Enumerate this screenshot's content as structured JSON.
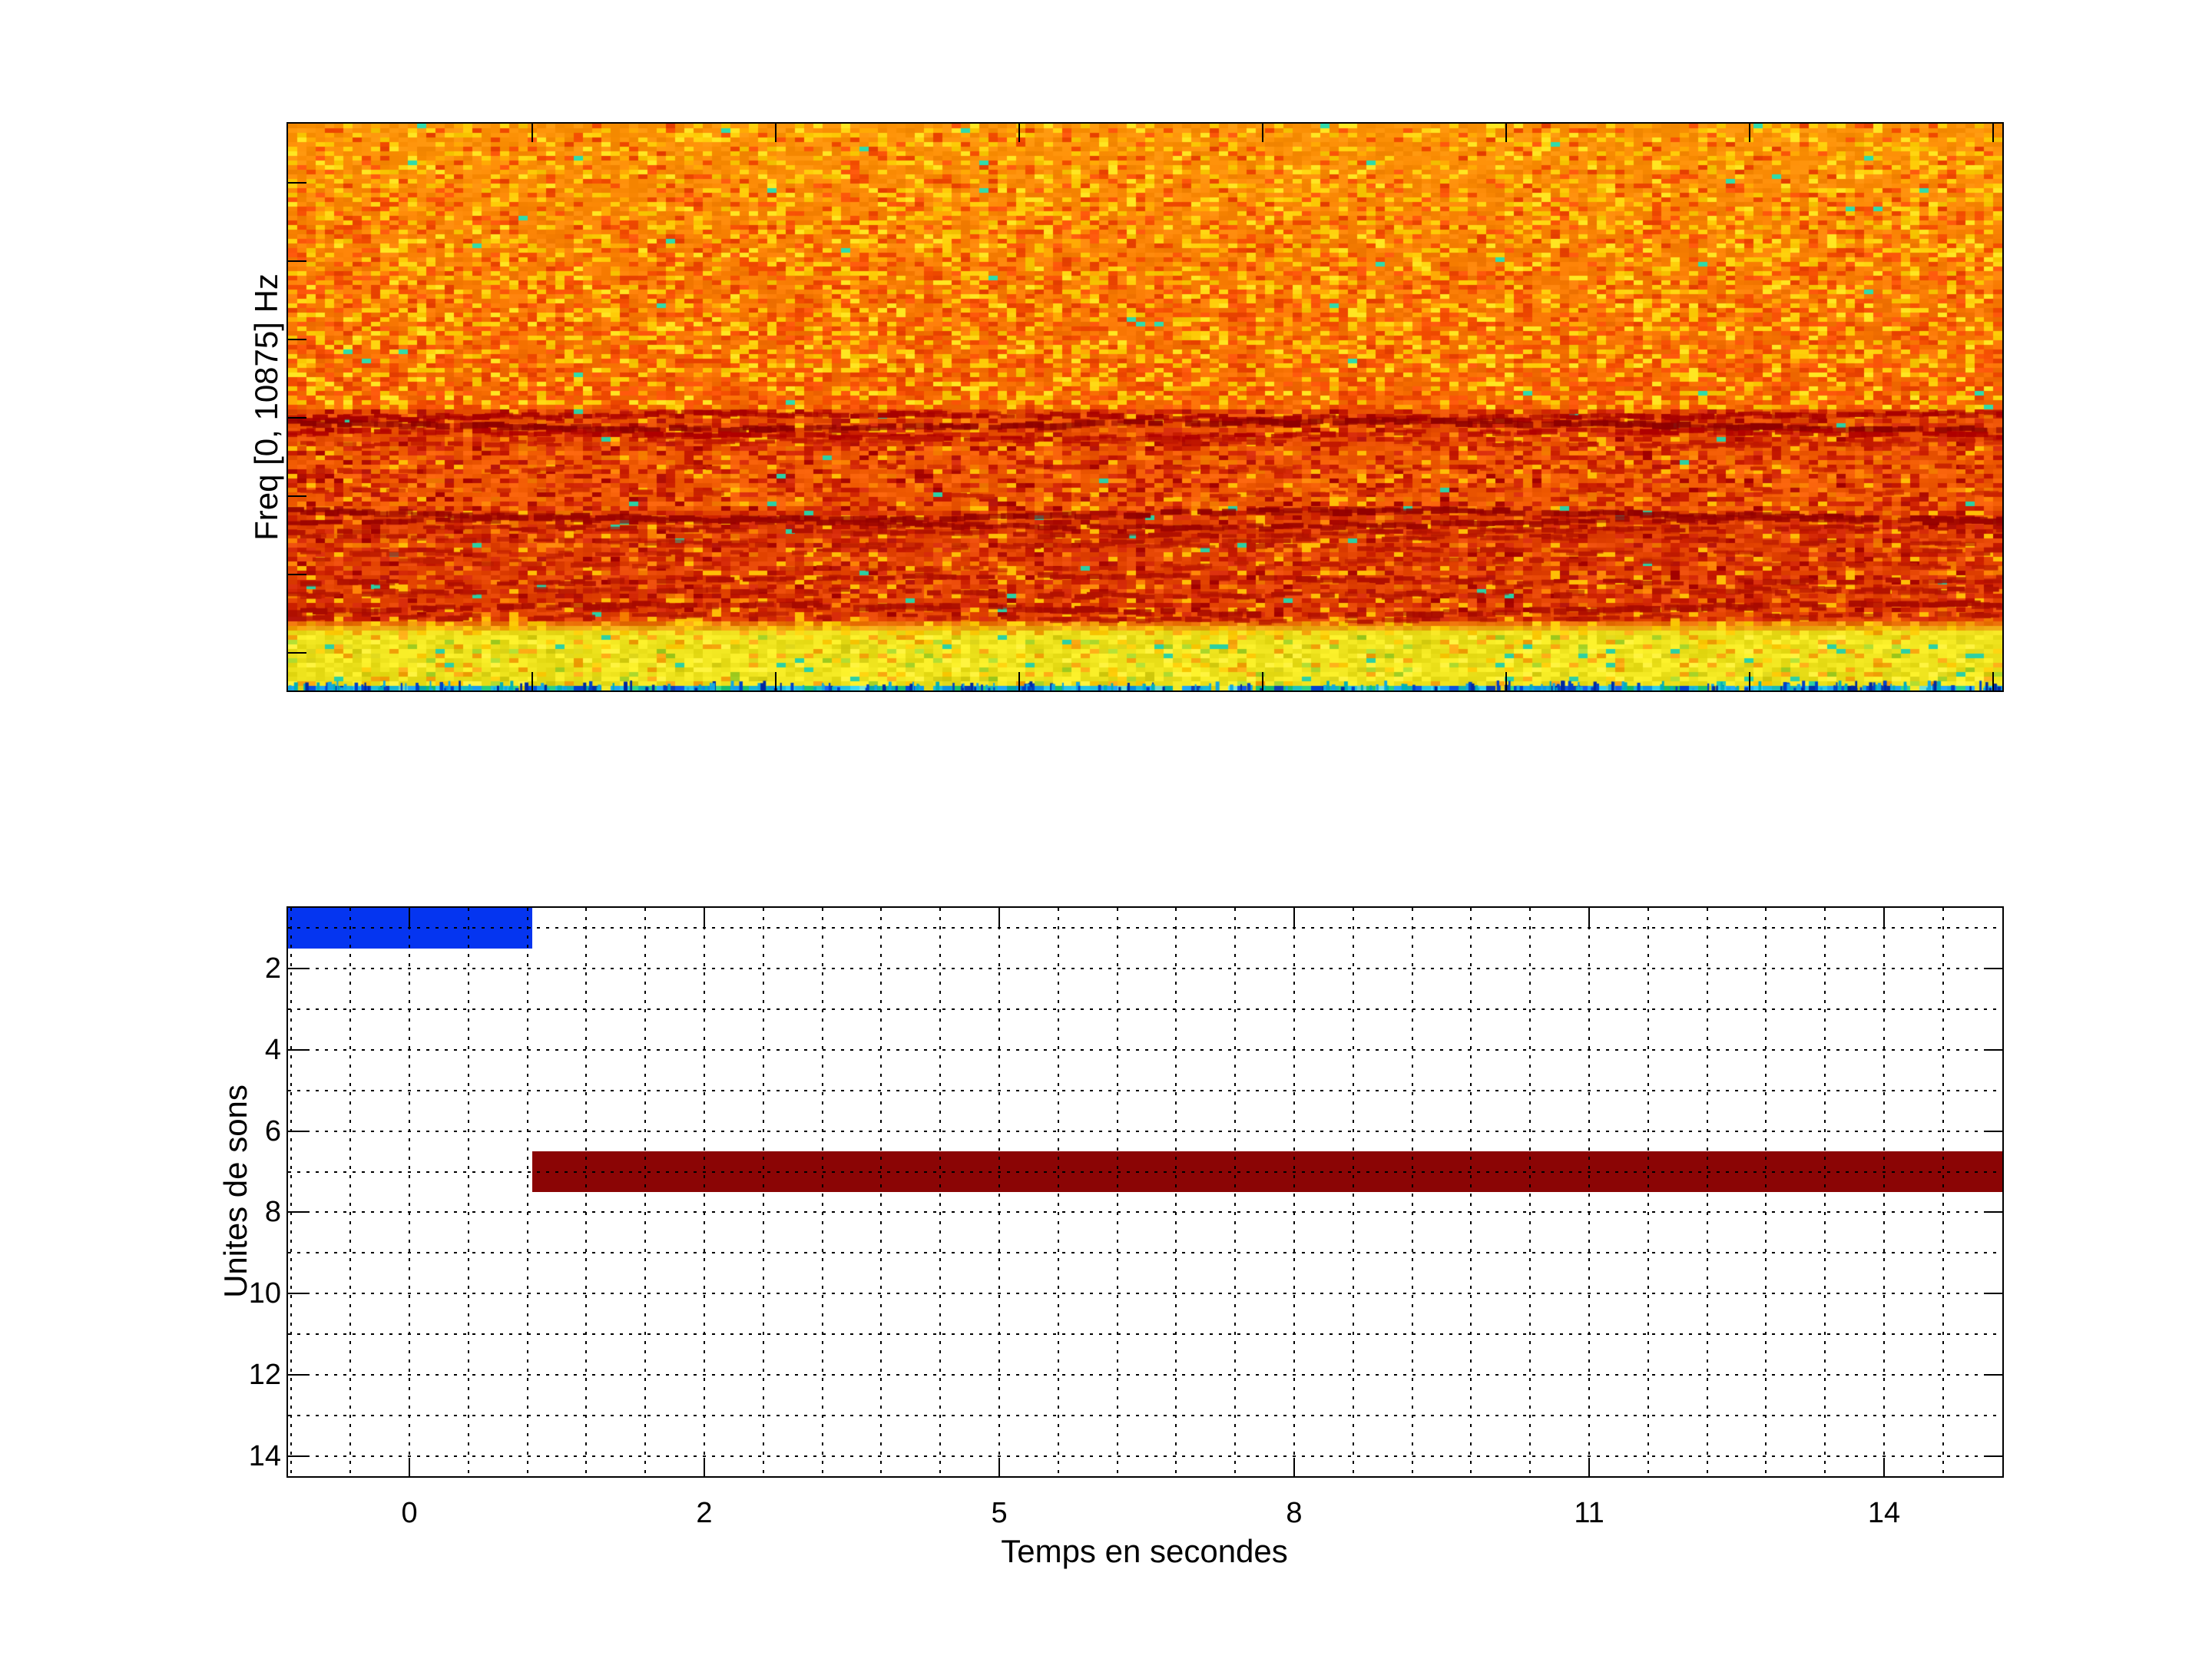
{
  "figure": {
    "background": "#FFFFFF"
  },
  "spectrogram": {
    "ylabel": "Freq [0, 10875] Hz",
    "freq_range_hz": [
      0,
      10875
    ],
    "left_tick_y_frac": [
      0.104,
      0.243,
      0.381,
      0.519,
      0.657,
      0.796,
      0.934
    ],
    "x_tick_x_frac": [
      0.1425,
      0.2845,
      0.4265,
      0.5685,
      0.7105,
      0.8525,
      0.9945
    ],
    "palette": {
      "orange_top": "#FC9206",
      "orange_deep": "#F56800",
      "yellow_speckle": "#FFCC08",
      "yellow_bright": "#FFE622",
      "amber": "#FFAA04",
      "red_speckle": "#F24C00",
      "cyan_dot": "#2EDCAC",
      "band_base_a": "#E84E00",
      "band_base_b": "#F05A02",
      "band_base_c": "#E04000",
      "band_base_d": "#E44402",
      "band_red": "#CE2200",
      "band_dark": "#AC0A00",
      "band_yellow": "#FFBE06",
      "band_orange": "#F87E00",
      "yellow_band": "#EFE41E",
      "yellow_hi": "#FFF440",
      "yellow_lo": "#D8D014",
      "green_speckle": "#A8D428",
      "teal_speckle": "#2CD0A4",
      "orange_in_yellow": "#F8A60E",
      "transition_from": "#E85A00",
      "bottom_row": [
        "#28C8E8",
        "#18A0F0",
        "#0A50E0",
        "#0030A8",
        "#22C878",
        "#10B4B4",
        "#E8E020",
        "#68D8D0"
      ],
      "bottom_row_w": [
        0.26,
        0.18,
        0.13,
        0.08,
        0.12,
        0.08,
        0.09,
        0.06
      ],
      "spike_colors": [
        "#0040C8",
        "#0028A0",
        "#00B0B8",
        "#12A8E0"
      ]
    },
    "streaks": [
      {
        "t": 0.512,
        "d": 0.85,
        "c": "#A80000",
        "th": 5
      },
      {
        "t": 0.527,
        "d": 0.92,
        "c": "#8E0000",
        "th": 6
      },
      {
        "t": 0.545,
        "d": 0.7,
        "c": "#B00000",
        "th": 5
      },
      {
        "t": 0.558,
        "d": 0.45,
        "c": "#C01800",
        "th": 4
      },
      {
        "t": 0.605,
        "d": 0.35,
        "c": "#C82400",
        "th": 4
      },
      {
        "t": 0.648,
        "d": 0.3,
        "c": "#C82400",
        "th": 4
      },
      {
        "t": 0.686,
        "d": 0.9,
        "c": "#920000",
        "th": 6
      },
      {
        "t": 0.701,
        "d": 0.85,
        "c": "#9C0400",
        "th": 5
      },
      {
        "t": 0.716,
        "d": 0.55,
        "c": "#B01000",
        "th": 4
      },
      {
        "t": 0.733,
        "d": 0.6,
        "c": "#B41400",
        "th": 4
      },
      {
        "t": 0.748,
        "d": 0.5,
        "c": "#BA1800",
        "th": 4
      },
      {
        "t": 0.775,
        "d": 0.4,
        "c": "#BE1C00",
        "th": 4
      },
      {
        "t": 0.8,
        "d": 0.55,
        "c": "#AE0E00",
        "th": 5
      },
      {
        "t": 0.824,
        "d": 0.55,
        "c": "#B21200",
        "th": 5
      },
      {
        "t": 0.852,
        "d": 0.65,
        "c": "#A80A00",
        "th": 6
      },
      {
        "t": 0.868,
        "d": 0.5,
        "c": "#B41400",
        "th": 4
      }
    ]
  },
  "activity_plot": {
    "xlabel": "Temps en secondes",
    "ylabel": "Unites de sons",
    "xtick_labels": [
      "0",
      "2",
      "5",
      "8",
      "11",
      "14"
    ],
    "xtick_x_frac": [
      0.0708,
      0.2428,
      0.4149,
      0.5869,
      0.759,
      0.931
    ],
    "ytick_labels": [
      "2",
      "4",
      "6",
      "8",
      "10",
      "12",
      "14"
    ],
    "ytick_values": [
      2,
      4,
      6,
      8,
      10,
      12,
      14
    ],
    "ylim": [
      0.5,
      14.5
    ],
    "hgrid_values": [
      1,
      2,
      3,
      4,
      5,
      6,
      7,
      8,
      9,
      10,
      11,
      12,
      13,
      14
    ],
    "vgrid_start_frac": 0.00197,
    "vgrid_step_frac": 0.03441,
    "vgrid_count": 30,
    "bars": [
      {
        "name": "sound-unit-1",
        "unit": 1,
        "color": "#0535F0",
        "x0_frac": 0.0,
        "x1_frac": 0.1425,
        "y_center": 1,
        "height_units": 1,
        "approx_time_s": [
          -0.8,
          0.8
        ]
      },
      {
        "name": "sound-unit-7",
        "unit": 7,
        "color": "#8B0505",
        "x0_frac": 0.1425,
        "x1_frac": 1.0,
        "y_center": 7,
        "height_units": 1,
        "approx_time_s": [
          0.8,
          15.6
        ]
      }
    ]
  },
  "chart_data": [
    {
      "type": "heatmap",
      "title": "",
      "ylabel": "Freq [0, 10875] Hz",
      "xlabel": "",
      "y_range_hz": [
        0,
        10875
      ],
      "colormap": "jet",
      "description": "Audio spectrogram, mostly saturated orange/red noise; darker red harmonic line clusters near 48-56% and 68-75% of height, bright yellow low-frequency band near the bottom (89-98% of height), thin cyan/blue rows at the very bottom edge.",
      "legend": "none",
      "grid": false
    },
    {
      "type": "bar",
      "orientation": "horizontal",
      "title": "",
      "xlabel": "Temps en secondes",
      "ylabel": "Unites de sons",
      "xtick_labels": [
        "0",
        "2",
        "5",
        "8",
        "11",
        "14"
      ],
      "ylim": [
        0.5,
        14.5
      ],
      "y_axis_reversed": true,
      "grid": true,
      "legend": "none",
      "series": [
        {
          "name": "unit-1-detection",
          "y": 1,
          "x_start_s": -0.8,
          "x_end_s": 0.8,
          "color": "#0535F0"
        },
        {
          "name": "unit-7-detection",
          "y": 7,
          "x_start_s": 0.8,
          "x_end_s": 15.6,
          "color": "#8B0505"
        }
      ]
    }
  ]
}
